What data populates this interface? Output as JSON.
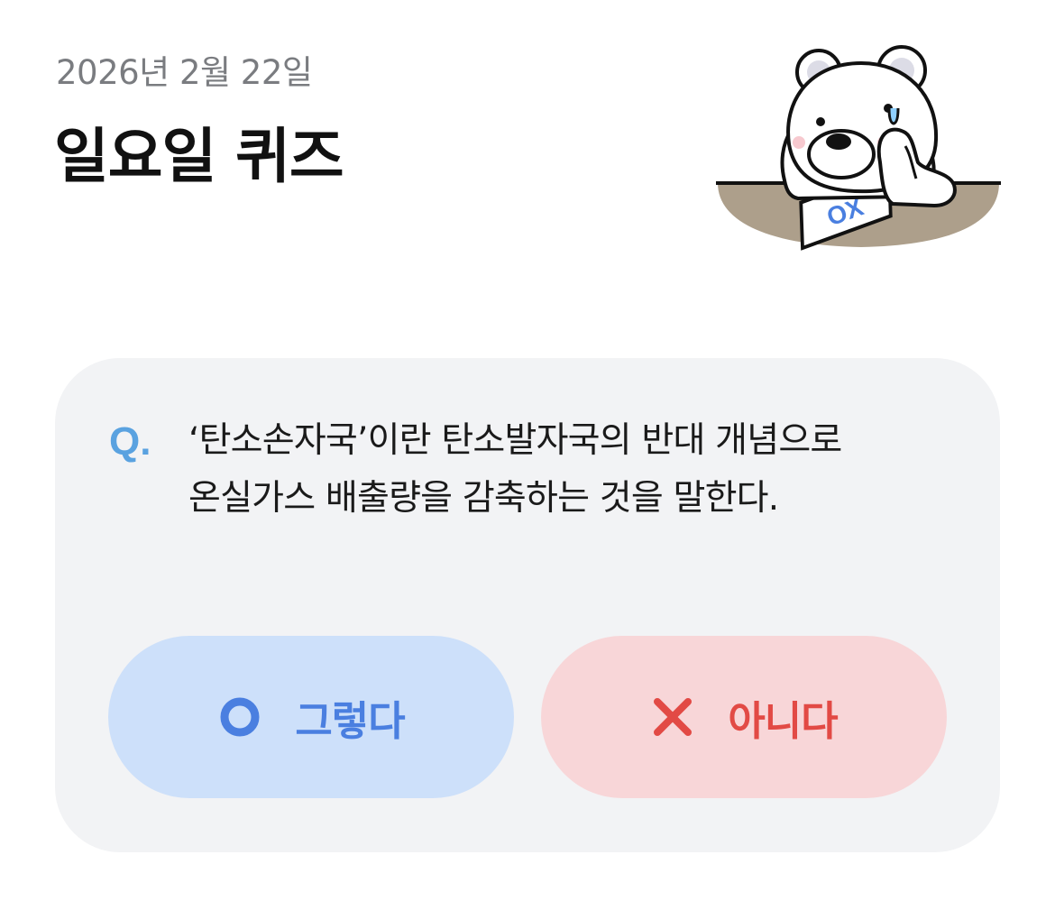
{
  "header": {
    "date": "2026년 2월 22일",
    "title": "일요일 퀴즈"
  },
  "quiz": {
    "q_mark": "Q.",
    "question_lines": [
      "‘탄소손자국’이란 탄소발자국의 반대 개념으로",
      "온실가스 배출량을 감축하는 것을 말한다."
    ],
    "answers": {
      "yes": {
        "label": "그렇다",
        "icon": "circle-o-icon",
        "color": "#4a7fe0",
        "bg": "#cde0fa"
      },
      "no": {
        "label": "아니다",
        "icon": "x-mark-icon",
        "color": "#e24a45",
        "bg": "#f8d6d8"
      }
    }
  },
  "mascot": {
    "paper_text": "OX"
  }
}
